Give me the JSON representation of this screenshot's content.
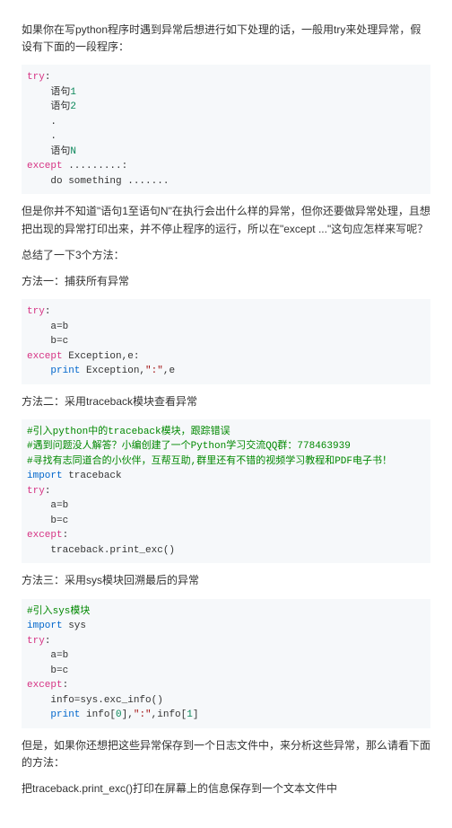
{
  "p1": "如果你在写python程序时遇到异常后想进行如下处理的话，一般用try来处理异常，假设有下面的一段程序：",
  "code1": {
    "l1a": "try",
    "l1b": ":",
    "l2a": "    语句",
    "l2b": "1",
    "l3a": "    语句",
    "l3b": "2",
    "l4": "    .",
    "l5": "    .",
    "l6a": "    语句",
    "l6b": "N",
    "l7a": "except",
    "l7b": " .........:",
    "l8": "    do something ......."
  },
  "p2": "但是你并不知道\"语句1至语句N\"在执行会出什么样的异常，但你还要做异常处理，且想把出现的异常打印出来，并不停止程序的运行，所以在\"except ...\"这句应怎样来写呢？",
  "p3": "总结了一下3个方法：",
  "p4": "方法一：捕获所有异常",
  "code2": {
    "l1a": "try",
    "l1b": ":",
    "l2": "    a=b",
    "l3": "    b=c",
    "l4a": "except",
    "l4b": " Exception,e:",
    "l5a": "    ",
    "l5b": "print",
    "l5c": " Exception,",
    "l5d": "\":\"",
    "l5e": ",e"
  },
  "p5": "方法二：采用traceback模块查看异常",
  "code3": {
    "l1": "#引入python中的traceback模块，跟踪错误",
    "l2": "#遇到问题没人解答？小编创建了一个Python学习交流QQ群：778463939",
    "l3": "#寻找有志同道合的小伙伴，互帮互助,群里还有不错的视频学习教程和PDF电子书！",
    "l4a": "import",
    "l4b": " traceback",
    "l5a": "try",
    "l5b": ":",
    "l6": "    a=b",
    "l7": "    b=c",
    "l8a": "except",
    "l8b": ":",
    "l9": "    traceback.print_exc()"
  },
  "p6": "方法三：采用sys模块回溯最后的异常",
  "code4": {
    "l1": "#引入sys模块",
    "l2a": "import",
    "l2b": " sys",
    "l3a": "try",
    "l3b": ":",
    "l4": "    a=b",
    "l5": "    b=c",
    "l6a": "except",
    "l6b": ":",
    "l7": "    info=sys.exc_info()",
    "l8a": "    ",
    "l8b": "print",
    "l8c": " info[",
    "l8d": "0",
    "l8e": "],",
    "l8f": "\":\"",
    "l8g": ",info[",
    "l8h": "1",
    "l8i": "]"
  },
  "p7": "但是，如果你还想把这些异常保存到一个日志文件中，来分析这些异常，那么请看下面的方法：",
  "p8": "把traceback.print_exc()打印在屏幕上的信息保存到一个文本文件中"
}
